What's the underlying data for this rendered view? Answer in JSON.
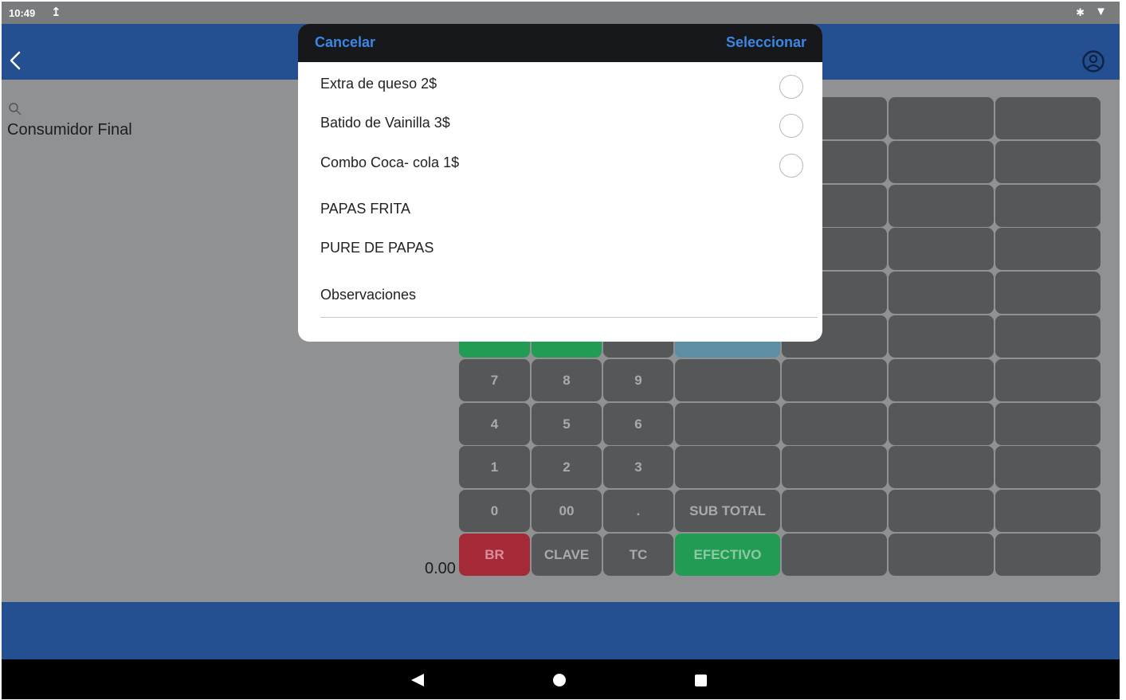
{
  "status_bar": {
    "time": "10:49",
    "upload_glyph": "↥",
    "bluetooth_glyph": "✱",
    "wifi_glyph": "▼"
  },
  "app_bar": {
    "back_icon": "chevron-left-icon",
    "account_icon": "account-circle-icon"
  },
  "main": {
    "customer": "Consumidor Final",
    "total": "0.00",
    "keypad": {
      "num_rows": [
        [
          "7",
          "8",
          "9",
          ""
        ],
        [
          "4",
          "5",
          "6",
          ""
        ],
        [
          "1",
          "2",
          "3",
          ""
        ],
        [
          "0",
          "00",
          ".",
          "SUB TOTAL"
        ],
        [
          "BR",
          "CLAVE",
          "TC",
          "EFECTIVO"
        ]
      ]
    }
  },
  "modal": {
    "cancel": "Cancelar",
    "select": "Seleccionar",
    "options": [
      {
        "label": "Extra de queso 2$",
        "selected": false
      },
      {
        "label": "Batido de Vainilla 3$",
        "selected": false
      },
      {
        "label": "Combo Coca- cola 1$",
        "selected": false
      }
    ],
    "items": [
      "PAPAS FRITA",
      "PURE DE PAPAS"
    ],
    "observations_label": "Observaciones"
  },
  "colors": {
    "app_bar": "#244f90",
    "modal_header": "#16181b",
    "accent_link": "#3b87e6",
    "key_gray": "#565759",
    "key_green": "#229c55",
    "key_red": "#a52a38",
    "key_teal": "#5e8ea4"
  }
}
